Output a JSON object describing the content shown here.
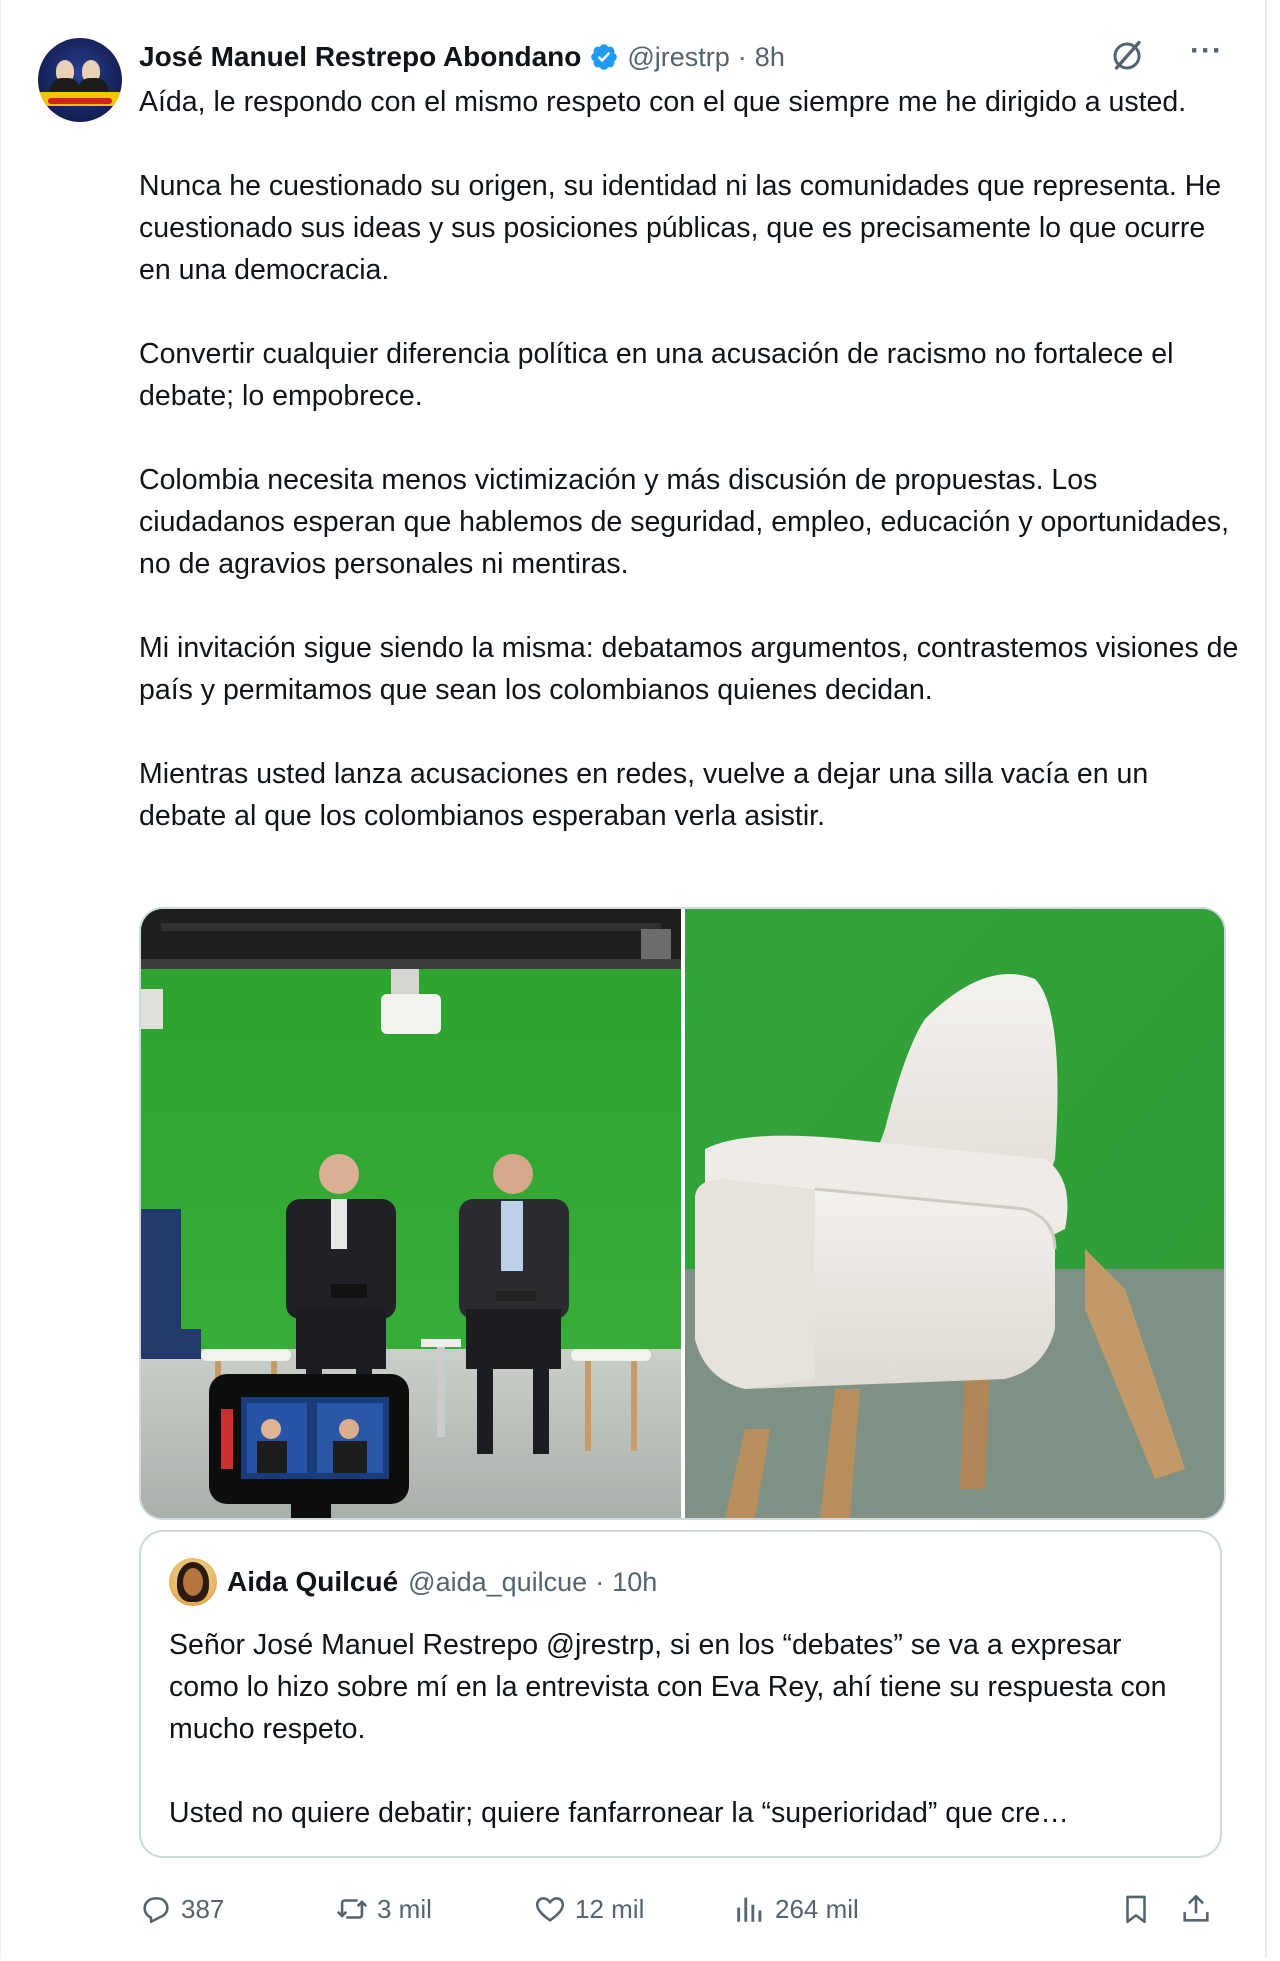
{
  "tweet": {
    "author_name": "José Manuel Restrepo Abondano",
    "handle": "@jrestrp",
    "separator": "·",
    "time": "8h",
    "more_label": "···",
    "paragraphs": [
      "Aída, le respondo con el mismo respeto con el que siempre me he dirigido a usted.",
      "Nunca he cuestionado su origen, su identidad ni las comunidades que representa. He cuestionado sus ideas y sus posiciones públicas, que es precisamente lo que ocurre en una democracia.",
      "Convertir cualquier diferencia política en una acusación de racismo no fortalece el debate; lo empobrece.",
      "Colombia necesita menos victimización y más discusión de propuestas. Los ciudadanos esperan que hablemos de seguridad, empleo, educación y oportunidades, no de agravios personales ni mentiras.",
      "Mi invitación sigue siendo la misma: debatamos argumentos, contrastemos visiones de país y permitamos que sean los colombianos quienes decidan.",
      "Mientras usted lanza acusaciones en redes, vuelve a dejar una silla vacía en un debate al que los colombianos esperaban verla asistir."
    ],
    "icons": {
      "verified": "verified-badge-icon",
      "grok": "grok-icon",
      "more": "more-icon"
    },
    "colors": {
      "verified_blue": "#1d9bf0",
      "secondary_text": "#536471",
      "border": "#cfd9de",
      "green_screen": "#2fa52f"
    }
  },
  "media": {
    "images": [
      {
        "name": "studio-image",
        "description_icon": "photo"
      },
      {
        "name": "empty-chair-image",
        "description_icon": "photo"
      }
    ]
  },
  "quote": {
    "author_name": "Aida Quilcué",
    "handle": "@aida_quilcue",
    "separator": "·",
    "time": "10h",
    "paragraphs": [
      "Señor José Manuel Restrepo @jrestrp, si en los “debates” se va a expresar como lo hizo sobre mí en la entrevista con Eva Rey, ahí tiene su respuesta con mucho respeto.",
      "Usted no quiere debatir; quiere fanfarronear la “superioridad” que cre…"
    ]
  },
  "actions": {
    "replies": "387",
    "reposts": "3 mil",
    "likes": "12 mil",
    "views": "264 mil",
    "icons": [
      "reply-icon",
      "repost-icon",
      "like-icon",
      "views-icon",
      "bookmark-icon",
      "share-icon"
    ]
  }
}
